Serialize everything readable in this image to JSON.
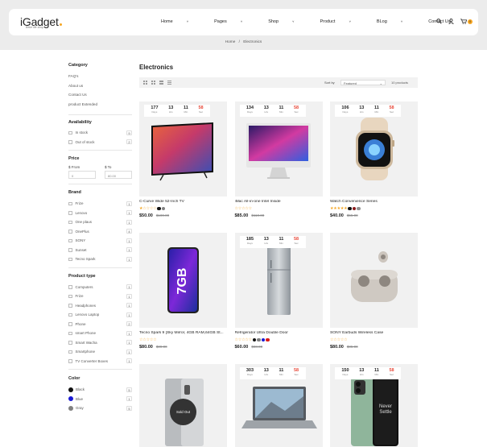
{
  "brand": {
    "name": "iGadget",
    "tagline": "Bebe life shop"
  },
  "nav": [
    {
      "label": "Home"
    },
    {
      "label": "Pages"
    },
    {
      "label": "Shop"
    },
    {
      "label": "Product"
    },
    {
      "label": "BLog"
    },
    {
      "label": "Contact Us"
    }
  ],
  "cart_count": "0",
  "breadcrumb": {
    "home": "Home",
    "sep": "/",
    "current": "Electronics"
  },
  "sidebar": {
    "category": {
      "title": "Category",
      "items": [
        "FAQ's",
        "About us",
        "Contact Us",
        "product Extended"
      ]
    },
    "availability": {
      "title": "Availability",
      "items": [
        {
          "label": "In stock",
          "count": "9"
        },
        {
          "label": "Out of stock",
          "count": "2"
        }
      ]
    },
    "price": {
      "title": "Price",
      "from_label": "$ From",
      "to_label": "$ To",
      "from_placeholder": "0",
      "to_placeholder": "80.00"
    },
    "brand": {
      "title": "Brand",
      "items": [
        {
          "label": "Frize",
          "count": "1"
        },
        {
          "label": "Lenovo",
          "count": "1"
        },
        {
          "label": "One plaus",
          "count": "1"
        },
        {
          "label": "OnePlus",
          "count": "4"
        },
        {
          "label": "SONY",
          "count": "1"
        },
        {
          "label": "Sunset",
          "count": "1"
        },
        {
          "label": "Tecno Spark",
          "count": "1"
        }
      ]
    },
    "product_type": {
      "title": "Product type",
      "items": [
        {
          "label": "Computers",
          "count": "1"
        },
        {
          "label": "Frize",
          "count": "1"
        },
        {
          "label": "Headphones",
          "count": "1"
        },
        {
          "label": "Lenovo Laptop",
          "count": "1"
        },
        {
          "label": "Phone",
          "count": "2"
        },
        {
          "label": "smart Phone",
          "count": "1"
        },
        {
          "label": "Smart Wacha",
          "count": "1"
        },
        {
          "label": "Smartphone",
          "count": "1"
        },
        {
          "label": "TV Converter Boxes",
          "count": "1"
        }
      ]
    },
    "color": {
      "title": "Color",
      "items": [
        {
          "label": "Black",
          "count": "5",
          "hex": "#111111"
        },
        {
          "label": "Blue",
          "count": "1",
          "hex": "#1a1ad4"
        },
        {
          "label": "Gray",
          "count": "5",
          "hex": "#808080"
        }
      ]
    }
  },
  "content": {
    "title": "Electronics",
    "sort_label": "Sort by",
    "sort_value": "Featured",
    "count_label": "10 products"
  },
  "timer_units": [
    "Days",
    "Hrs",
    "Min",
    "Sec"
  ],
  "products": [
    {
      "name": "C-Curve Wide 52-Inch TV",
      "price": "$50.00",
      "old": "$100.00",
      "timer": [
        "177",
        "13",
        "11",
        "58"
      ],
      "colors": [
        "#111111",
        "#808080"
      ],
      "rating": 1,
      "img": "tv"
    },
    {
      "name": "iMac All-in-one Intel Inside",
      "price": "$85.00",
      "old": "$110.00",
      "timer": [
        "134",
        "13",
        "11",
        "58"
      ],
      "colors": [],
      "rating": 0,
      "img": "imac"
    },
    {
      "name": "Watch Convenience Series",
      "price": "$40.00",
      "old": "$55.00",
      "timer": [
        "106",
        "13",
        "11",
        "58"
      ],
      "colors": [
        "#111111",
        "#8b1a1a",
        "#909090"
      ],
      "rating": 5,
      "img": "watch"
    },
    {
      "name": "Tecno Spark 9 [Sky Mirror, 4GB RAM,64GB St...",
      "price": "$80.00",
      "old": "$89.00",
      "timer": null,
      "colors": [],
      "rating": 0,
      "img": "phone"
    },
    {
      "name": "Refrigerator Ultra Double Door",
      "price": "$60.00",
      "old": "$88.00",
      "timer": [
        "185",
        "13",
        "11",
        "58"
      ],
      "colors": [
        "#111111",
        "#808080",
        "#1a1ad4",
        "#d81b1b"
      ],
      "rating": 0,
      "img": "fridge"
    },
    {
      "name": "SONY Earbuds Wireless Case",
      "price": "$80.00",
      "old": "$85.00",
      "timer": null,
      "colors": [],
      "rating": 0,
      "img": "earbuds"
    },
    {
      "name": "",
      "price": "",
      "old": "",
      "timer": null,
      "colors": [],
      "rating": 0,
      "img": "oppo",
      "soldout": "Sold Out"
    },
    {
      "name": "",
      "price": "",
      "old": "",
      "timer": [
        "303",
        "13",
        "11",
        "58"
      ],
      "colors": [],
      "rating": 0,
      "img": "laptop"
    },
    {
      "name": "",
      "price": "",
      "old": "",
      "timer": [
        "150",
        "13",
        "11",
        "58"
      ],
      "colors": [],
      "rating": 0,
      "img": "oneplus"
    }
  ]
}
